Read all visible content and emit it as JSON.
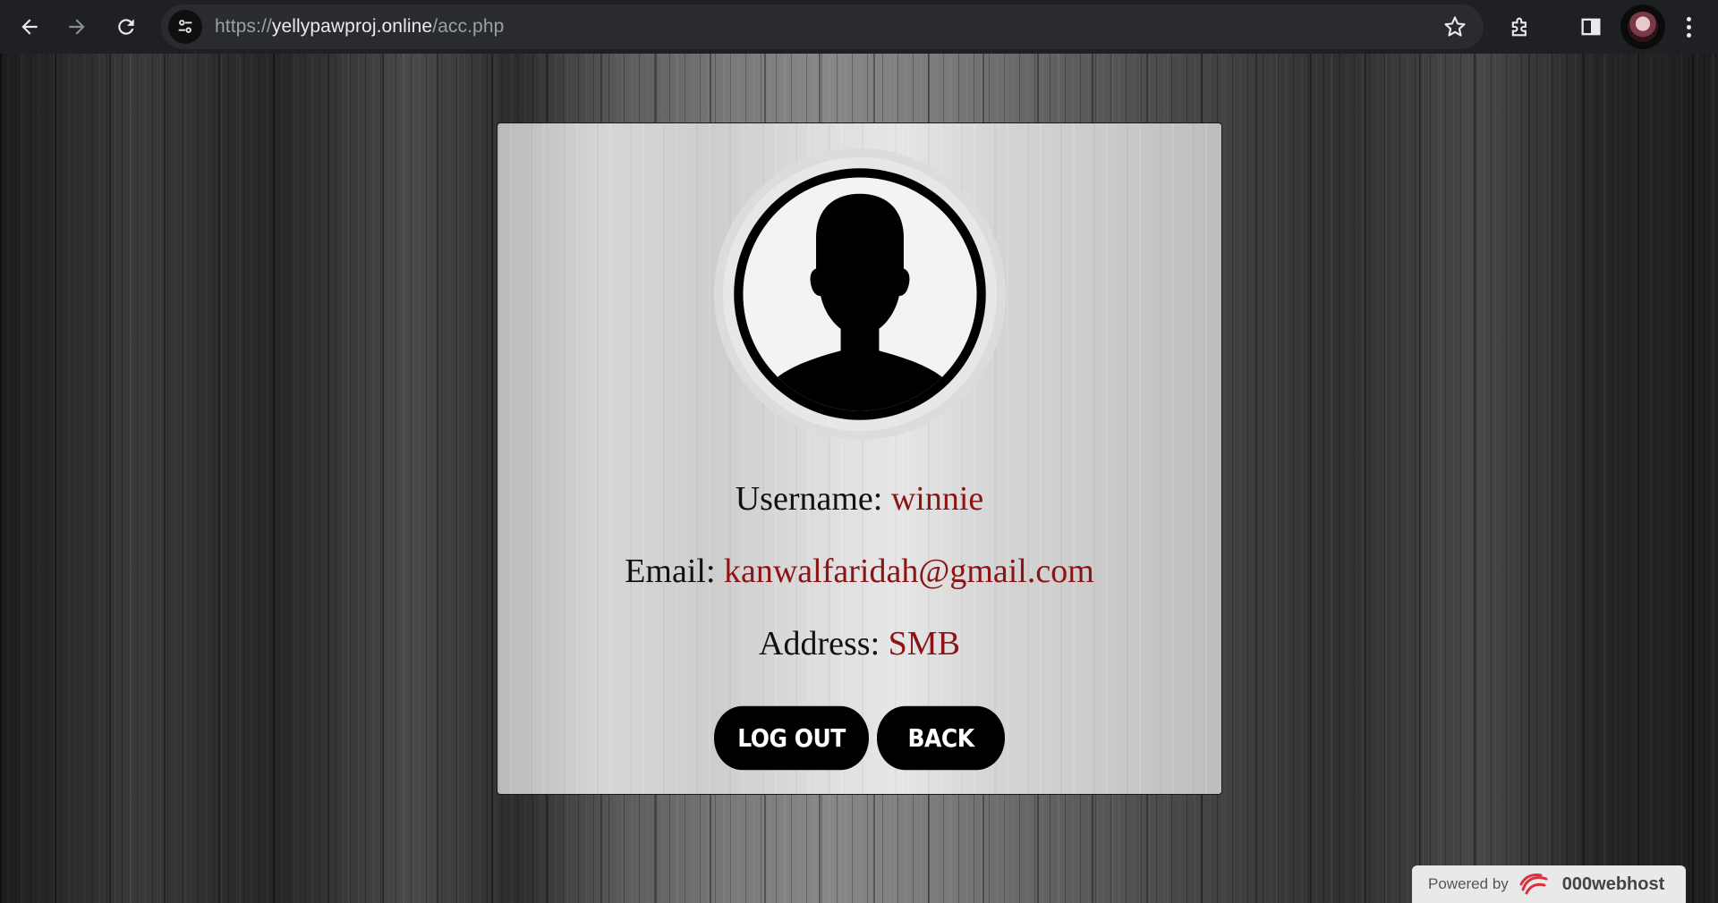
{
  "browser": {
    "url_scheme": "https://",
    "url_host": "yellypawproj.online",
    "url_path": "/acc.php"
  },
  "profile": {
    "username_label": "Username:",
    "username_value": "winnie",
    "email_label": "Email:",
    "email_value": "kanwalfaridah@gmail.com",
    "address_label": "Address:",
    "address_value": "SMB"
  },
  "buttons": {
    "logout": "LOG OUT",
    "back": "BACK"
  },
  "footer": {
    "powered_by": "Powered by",
    "brand": "000webhost"
  },
  "colors": {
    "value_text": "#8b1414",
    "button_bg": "#000000"
  }
}
